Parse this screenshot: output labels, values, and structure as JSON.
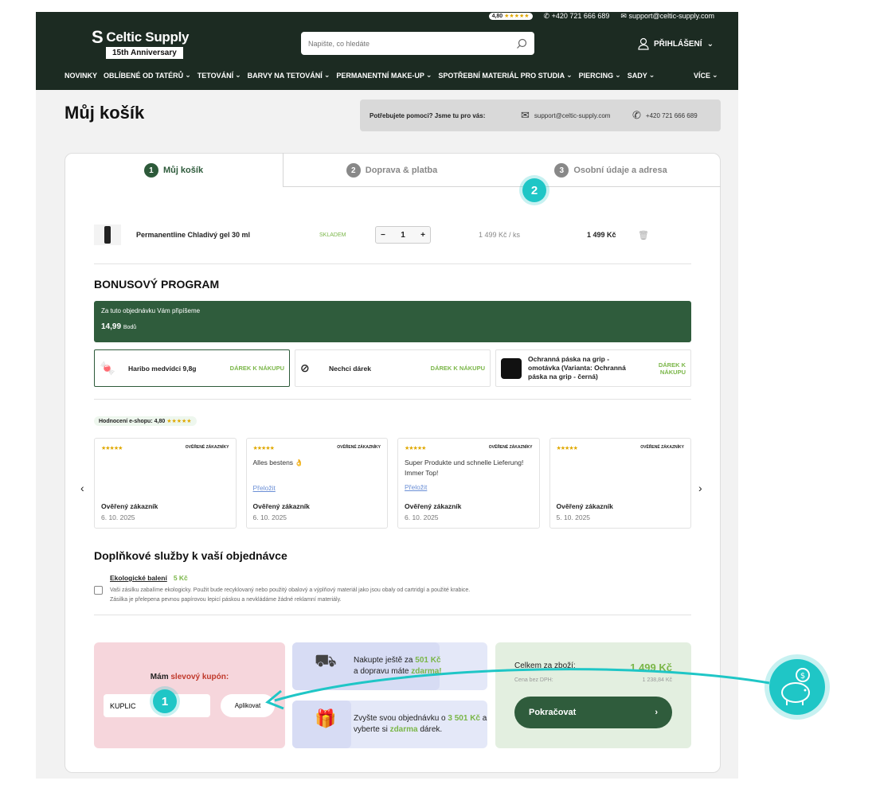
{
  "header": {
    "rating": "4,80",
    "rating_stars": "★★★★★",
    "phone": "+420 721 666 689",
    "email": "support@celtic-supply.com",
    "brand": "Celtic Supply",
    "anniversary": "15th Anniversary",
    "search_placeholder": "Napište, co hledáte",
    "login": "PŘIHLÁŠENÍ",
    "nav": [
      "NOVINKY",
      "OBLÍBENÉ OD TATÉRŮ",
      "TETOVÁNÍ",
      "BARVY NA TETOVÁNÍ",
      "PERMANENTNÍ MAKE-UP",
      "SPOTŘEBNÍ MATERIÁL PRO STUDIA",
      "PIERCING",
      "SADY"
    ],
    "more": "VÍCE"
  },
  "page": {
    "title": "Můj košík",
    "help_question": "Potřebujete pomoci? Jsme tu pro vás:",
    "help_email": "support@celtic-supply.com",
    "help_phone": "+420 721 666 689"
  },
  "steps": [
    {
      "num": "1",
      "label": "Můj košík"
    },
    {
      "num": "2",
      "label": "Doprava & platba"
    },
    {
      "num": "3",
      "label": "Osobní údaje a adresa"
    }
  ],
  "item": {
    "name": "Permanentline Chladivý gel 30 ml",
    "stock": "SKLADEM",
    "qty": "1",
    "unit_price": "1 499 Kč",
    "unit": "/ ks",
    "total": "1 499 Kč"
  },
  "bonus": {
    "heading": "BONUSOVÝ PROGRAM",
    "text": "Za tuto objednávku Vám připíšeme",
    "points": "14,99",
    "points_unit": "Bodů",
    "gifts": [
      {
        "name": "Haribo medvídci 9,8g",
        "tag": "DÁREK K NÁKUPU"
      },
      {
        "name": "Nechci dárek",
        "tag": "DÁREK K NÁKUPU"
      },
      {
        "name": "Ochranná páska na grip - omotávka (Varianta: Ochranná páska na grip - černá)",
        "tag": "DÁREK K NÁKUPU"
      }
    ]
  },
  "reviews": {
    "badge_label": "Hodnocení e-shopu:",
    "badge_value": "4,80",
    "stars": "★★★★★",
    "logo": "OVĚŘENÉ ZÁKAZNÍKY",
    "translate": "Přeložit",
    "items": [
      {
        "text": "",
        "who": "Ověřený zákazník",
        "date": "6. 10. 2025"
      },
      {
        "text": "Alles bestens 👌",
        "who": "Ověřený zákazník",
        "date": "6. 10. 2025"
      },
      {
        "text": "Super Produkte und schnelle Lieferung! Immer Top!",
        "who": "Ověřený zákazník",
        "date": "6. 10. 2025"
      },
      {
        "text": "",
        "who": "Ověřený zákazník",
        "date": "5. 10. 2025"
      }
    ]
  },
  "services": {
    "heading": "Doplňkové služby k vaší objednávce",
    "name": "Ekologické balení",
    "price": "5 Kč",
    "desc1": "Vaši zásilku zabalíme ekologicky. Použit bude recyklovaný nebo použitý obalový a výplňový materiál jako jsou obaly od cartridgí a použité krabice.",
    "desc2": "Zásilka je přelepena pevnou papírovou lepicí páskou a nevkládáme žádné reklamní materiály."
  },
  "coupon": {
    "label_prefix": "Mám",
    "label_accent": "slevový kupón:",
    "value": "KUPLIC",
    "apply": "Aplikovat"
  },
  "promo": {
    "shipping_a": "Nakupte ještě za",
    "shipping_amt": "501 Kč",
    "shipping_b": "a dopravu máte",
    "shipping_free": "zdarma!",
    "gift_a": "Zvyšte svou objednávku o",
    "gift_amt": "3 501 Kč",
    "gift_b": "a vyberte si",
    "gift_free": "zdarma",
    "gift_c": "dárek."
  },
  "totals": {
    "label": "Celkem za zboží:",
    "value": "1 499 Kč",
    "net_label": "Cena bez DPH:",
    "net_value": "1 238,84 Kč",
    "continue": "Pokračovat"
  },
  "markers": {
    "one": "1",
    "two": "2"
  },
  "colors": {
    "accent": "#2f5c3c",
    "marker": "#1fc6c6",
    "green_text": "#7ab648"
  }
}
